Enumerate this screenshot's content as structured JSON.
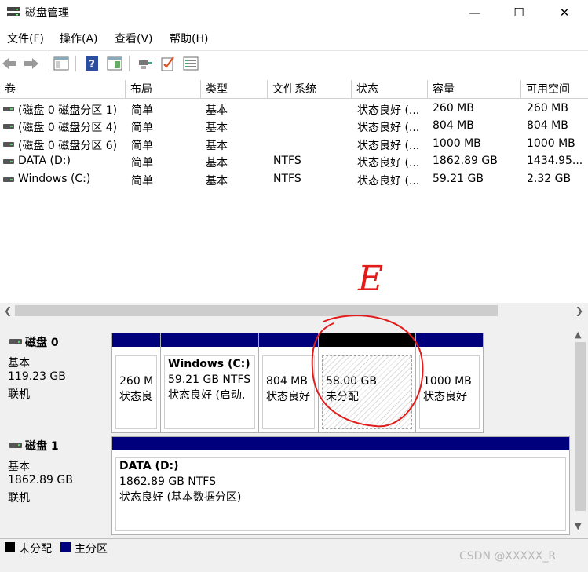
{
  "window": {
    "title": "磁盘管理",
    "controls": {
      "minimize": "—",
      "maximize": "☐",
      "close": "✕"
    }
  },
  "menu": [
    "文件(F)",
    "操作(A)",
    "查看(V)",
    "帮助(H)"
  ],
  "toolbar": {
    "icons": [
      "back-arrow-icon",
      "forward-arrow-icon",
      "properties-icon",
      "help-icon",
      "show-pane-icon",
      "connect-icon",
      "check-icon",
      "details-icon"
    ]
  },
  "volume_table": {
    "columns": [
      "卷",
      "布局",
      "类型",
      "文件系统",
      "状态",
      "容量",
      "可用空间"
    ],
    "rows": [
      [
        "(磁盘 0 磁盘分区 1)",
        "简单",
        "基本",
        "",
        "状态良好 (...",
        "260 MB",
        "260 MB"
      ],
      [
        "(磁盘 0 磁盘分区 4)",
        "简单",
        "基本",
        "",
        "状态良好 (...",
        "804 MB",
        "804 MB"
      ],
      [
        "(磁盘 0 磁盘分区 6)",
        "简单",
        "基本",
        "",
        "状态良好 (...",
        "1000 MB",
        "1000 MB"
      ],
      [
        "DATA (D:)",
        "简单",
        "基本",
        "NTFS",
        "状态良好 (...",
        "1862.89 GB",
        "1434.95..."
      ],
      [
        "Windows (C:)",
        "简单",
        "基本",
        "NTFS",
        "状态良好 (...",
        "59.21 GB",
        "2.32 GB"
      ]
    ]
  },
  "disks": [
    {
      "name": "磁盘 0",
      "type": "基本",
      "size": "119.23 GB",
      "status": "联机",
      "partitions": [
        {
          "title": "",
          "line1": "260 M",
          "line2": "状态良",
          "bar": "#00007c"
        },
        {
          "title": "Windows  (C:)",
          "line1": "59.21 GB NTFS",
          "line2": "状态良好 (启动,",
          "bar": "#00007c"
        },
        {
          "title": "",
          "line1": "804 MB",
          "line2": "状态良好",
          "bar": "#00007c"
        },
        {
          "title": "",
          "line1": "58.00 GB",
          "line2": "未分配",
          "bar": "#000000"
        },
        {
          "title": "",
          "line1": "1000 MB",
          "line2": "状态良好",
          "bar": "#00007c"
        }
      ]
    },
    {
      "name": "磁盘 1",
      "type": "基本",
      "size": "1862.89 GB",
      "status": "联机",
      "partitions": [
        {
          "title": "DATA  (D:)",
          "line1": "1862.89 GB NTFS",
          "line2": "状态良好 (基本数据分区)",
          "bar": "#00007c"
        }
      ]
    }
  ],
  "legend": [
    {
      "label": "未分配",
      "color": "#000000"
    },
    {
      "label": "主分区",
      "color": "#00007c"
    }
  ],
  "annotation": {
    "letter": "E",
    "color": "#e21b1b"
  },
  "watermark": "CSDN @XXXXX_R"
}
